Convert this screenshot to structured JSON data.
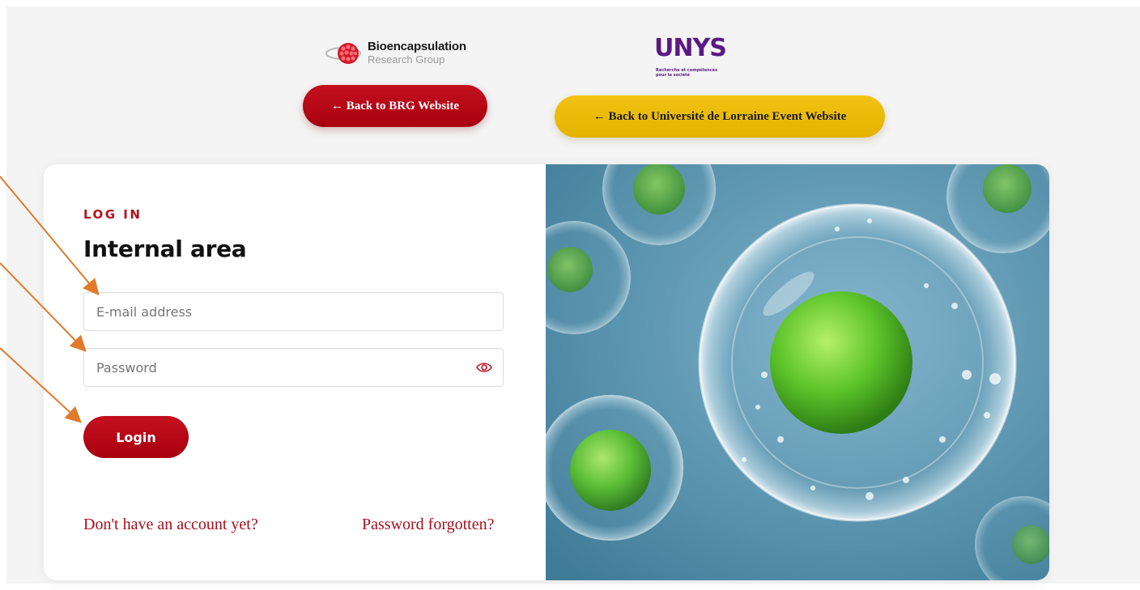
{
  "logos": {
    "brg": {
      "name": "Bioencapsulation",
      "sub": "Research Group"
    },
    "unys": {
      "word": "UNYS",
      "sub": "Recherche et compétences pour la société"
    }
  },
  "nav": {
    "back_brg": "← Back to BRG Website",
    "back_ul": "← Back to Université de Lorraine Event Website"
  },
  "login": {
    "eyebrow": "LOG IN",
    "title": "Internal area",
    "email_placeholder": "E-mail address",
    "password_placeholder": "Password",
    "submit": "Login",
    "signup_link": "Don't have an account yet?",
    "forgot_link": "Password forgotten?"
  },
  "colors": {
    "brand_red": "#b5121b",
    "accent_yellow": "#f2c313",
    "unys_purple": "#5a1a82",
    "annotation_arrow": "#e07b2a"
  }
}
